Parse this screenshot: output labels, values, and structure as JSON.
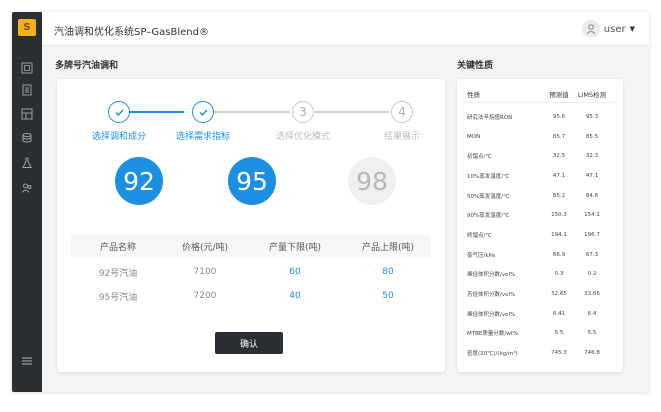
{
  "app": {
    "title": "汽油调和优化系统SP–GasBlend®",
    "user": "user"
  },
  "sidebar": {
    "logo": "S",
    "items": [
      "dashboard-icon",
      "report-icon",
      "data-icon",
      "database-icon",
      "flask-icon",
      "users-icon"
    ],
    "bottom": "menu-icon"
  },
  "main": {
    "section_title": "多牌号汽油调和",
    "steps": [
      {
        "index": "1",
        "label": "选择调和成分",
        "status": "done"
      },
      {
        "index": "2",
        "label": "选择需求指标",
        "status": "done"
      },
      {
        "index": "3",
        "label": "选择优化模式",
        "status": "todo"
      },
      {
        "index": "4",
        "label": "结果展示",
        "status": "todo"
      }
    ],
    "grades": [
      {
        "value": "92",
        "active": true
      },
      {
        "value": "95",
        "active": true
      },
      {
        "value": "98",
        "active": false
      }
    ],
    "table": {
      "headers": [
        "产品名称",
        "价格(元/吨)",
        "产量下限(吨)",
        "产品上限(吨)"
      ],
      "rows": [
        [
          "92号汽油",
          "7100",
          "60",
          "80"
        ],
        [
          "95号汽油",
          "7200",
          "40",
          "50"
        ]
      ]
    },
    "confirm_label": "确认"
  },
  "properties": {
    "section_title": "关键性质",
    "headers": [
      "性质",
      "预测值",
      "LIMS检测"
    ],
    "rows": [
      [
        "研究法辛烷值RON",
        "95.6",
        "95.3"
      ],
      [
        "MON",
        "85.7",
        "85.5"
      ],
      [
        "初馏点/℃",
        "32.5",
        "32.3"
      ],
      [
        "10%蒸发温度/℃",
        "47.1",
        "47.1"
      ],
      [
        "50%蒸发温度/℃",
        "85.2",
        "84.6"
      ],
      [
        "90%蒸发温度/℃",
        "150.3",
        "154.1"
      ],
      [
        "终馏点/℃",
        "194.1",
        "196.7"
      ],
      [
        "蒸气压/kPa",
        "66.9",
        "67.3"
      ],
      [
        "烯烃体积分数/vol%",
        "0.3",
        "0.2"
      ],
      [
        "芳烃体积分数/vol%",
        "32.65",
        "33.66"
      ],
      [
        "烯烃体积分数/vol%",
        "6.41",
        "6.4"
      ],
      [
        "MTBE质量分数/wt%",
        "5.5",
        "5.5"
      ],
      [
        "密度(20℃)/(kg/m³)",
        "745.3",
        "746.8"
      ]
    ]
  },
  "colors": {
    "accent": "#1a8fe3",
    "sidebar": "#2b2e33",
    "logo": "#f2b01e"
  }
}
